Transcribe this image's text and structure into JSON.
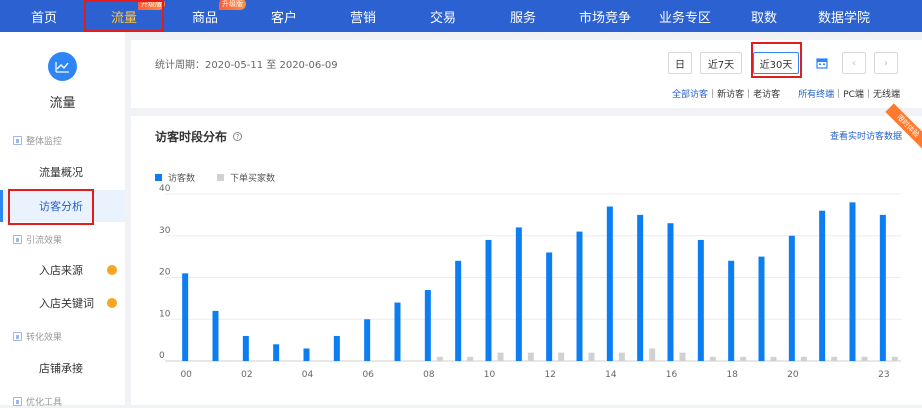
{
  "topnav": {
    "items": [
      {
        "label": "首页"
      },
      {
        "label": "流量",
        "badge": "升级版",
        "active": true
      },
      {
        "label": "商品",
        "badge": "升级版"
      },
      {
        "label": "客户"
      },
      {
        "label": "营销"
      },
      {
        "label": "交易"
      },
      {
        "label": "服务"
      },
      {
        "label": "市场竞争"
      },
      {
        "label": "业务专区"
      },
      {
        "label": "取数"
      },
      {
        "label": "数据学院"
      }
    ]
  },
  "sidebar": {
    "title": "流量",
    "groups": [
      {
        "label": "整体监控"
      },
      {
        "label": "引流效果"
      },
      {
        "label": "转化效果"
      },
      {
        "label": "优化工具"
      }
    ],
    "items": [
      {
        "label": "流量概况"
      },
      {
        "label": "访客分析"
      },
      {
        "label": "入店来源"
      },
      {
        "label": "入店关键词"
      },
      {
        "label": "店铺承接"
      }
    ]
  },
  "period": {
    "label": "统计周期：2020-05-11 至 2020-06-09",
    "buttons": [
      {
        "label": "日"
      },
      {
        "label": "近7天"
      },
      {
        "label": "近30天"
      }
    ],
    "visitor_filters": [
      {
        "label": "全部访客"
      },
      {
        "label": "新访客"
      },
      {
        "label": "老访客"
      }
    ],
    "device_filters": [
      {
        "label": "所有终端"
      },
      {
        "label": "PC端"
      },
      {
        "label": "无线端"
      }
    ]
  },
  "card": {
    "title": "访客时段分布",
    "help": "?",
    "link": "查看实时访客数据",
    "ribbon": "限时体验"
  },
  "colors": {
    "nav_bg": "#2b61d1",
    "accent": "#2e86f5",
    "series_visitors": "#0d7df2",
    "series_buyers": "#d1d1d1",
    "highlight": "#e21d1d",
    "badge": "#ff7a2e"
  },
  "chart_data": {
    "type": "bar",
    "x": [
      0,
      1,
      2,
      3,
      4,
      5,
      6,
      7,
      8,
      9,
      10,
      11,
      12,
      13,
      14,
      15,
      16,
      17,
      18,
      19,
      20,
      21,
      22,
      23
    ],
    "tick_labels": [
      "00",
      "02",
      "04",
      "06",
      "08",
      "10",
      "12",
      "14",
      "16",
      "18",
      "20",
      "23"
    ],
    "tick_positions": [
      0,
      2,
      4,
      6,
      8,
      10,
      12,
      14,
      16,
      18,
      20,
      23
    ],
    "ylim": [
      0,
      40
    ],
    "yticks": [
      0,
      10,
      20,
      30,
      40
    ],
    "grid": true,
    "legend_position": "top-left",
    "series": [
      {
        "name": "访客数",
        "values": [
          21,
          12,
          6,
          4,
          3,
          6,
          10,
          14,
          17,
          24,
          29,
          32,
          26,
          31,
          37,
          35,
          33,
          29,
          24,
          25,
          30,
          36,
          38,
          35
        ]
      },
      {
        "name": "下单买家数",
        "values": [
          0,
          0,
          0,
          0,
          0,
          0,
          0,
          0,
          1,
          1,
          2,
          2,
          2,
          2,
          2,
          3,
          2,
          1,
          1,
          1,
          1,
          1,
          1,
          1
        ]
      }
    ]
  }
}
